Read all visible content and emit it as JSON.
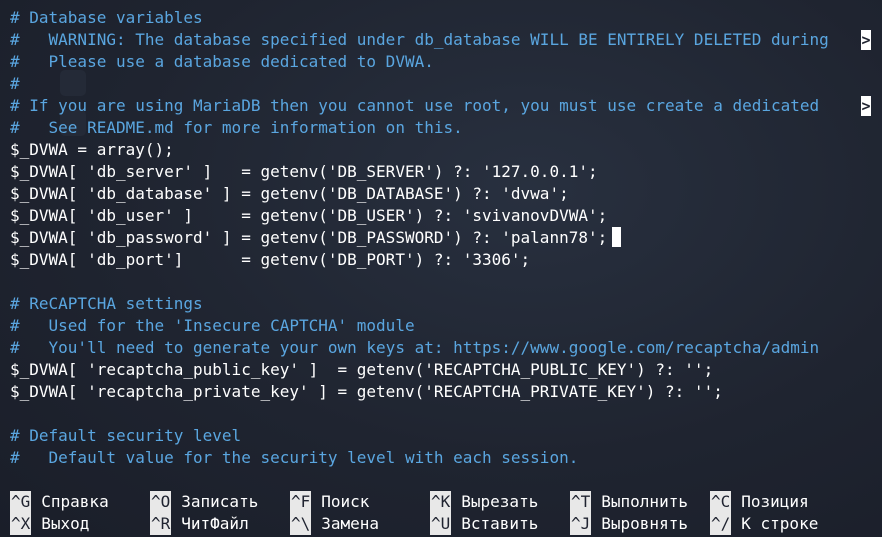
{
  "editor": {
    "lines": [
      {
        "text": "# Database variables",
        "kind": "comment"
      },
      {
        "text": "#   WARNING: The database specified under db_database WILL BE ENTIRELY DELETED during",
        "kind": "comment"
      },
      {
        "text": "#   Please use a database dedicated to DVWA.",
        "kind": "comment"
      },
      {
        "text": "#",
        "kind": "comment"
      },
      {
        "text": "# If you are using MariaDB then you cannot use root, you must use create a dedicated ",
        "kind": "comment"
      },
      {
        "text": "#   See README.md for more information on this.",
        "kind": "comment"
      },
      {
        "text": "$_DVWA = array();",
        "kind": "code"
      },
      {
        "text": "$_DVWA[ 'db_server' ]   = getenv('DB_SERVER') ?: '127.0.0.1';",
        "kind": "code"
      },
      {
        "text": "$_DVWA[ 'db_database' ] = getenv('DB_DATABASE') ?: 'dvwa';",
        "kind": "code"
      },
      {
        "text": "$_DVWA[ 'db_user' ]     = getenv('DB_USER') ?: 'svivanovDVWA';",
        "kind": "code"
      },
      {
        "text": "$_DVWA[ 'db_password' ] = getenv('DB_PASSWORD') ?: 'palann78';",
        "kind": "code"
      },
      {
        "text": "$_DVWA[ 'db_port']      = getenv('DB_PORT') ?: '3306';",
        "kind": "code"
      },
      {
        "text": "",
        "kind": "code"
      },
      {
        "text": "# ReCAPTCHA settings",
        "kind": "comment"
      },
      {
        "text": "#   Used for the 'Insecure CAPTCHA' module",
        "kind": "comment"
      },
      {
        "text": "#   You'll need to generate your own keys at: https://www.google.com/recaptcha/admin",
        "kind": "comment"
      },
      {
        "text": "$_DVWA[ 'recaptcha_public_key' ]  = getenv('RECAPTCHA_PUBLIC_KEY') ?: '';",
        "kind": "code"
      },
      {
        "text": "$_DVWA[ 'recaptcha_private_key' ] = getenv('RECAPTCHA_PRIVATE_KEY') ?: '';",
        "kind": "code"
      },
      {
        "text": "",
        "kind": "code"
      },
      {
        "text": "# Default security level",
        "kind": "comment"
      },
      {
        "text": "#   Default value for the security level with each session.",
        "kind": "comment"
      }
    ],
    "overflow_marker": ">"
  },
  "shortcuts": [
    {
      "key": "^G",
      "label": "Справка"
    },
    {
      "key": "^O",
      "label": "Записать"
    },
    {
      "key": "^F",
      "label": "Поиск"
    },
    {
      "key": "^K",
      "label": "Вырезать"
    },
    {
      "key": "^T",
      "label": "Выполнить"
    },
    {
      "key": "^C",
      "label": "Позиция"
    },
    {
      "key": "^X",
      "label": "Выход"
    },
    {
      "key": "^R",
      "label": "ЧитФайл"
    },
    {
      "key": "^\\",
      "label": "Замена"
    },
    {
      "key": "^U",
      "label": "Вставить"
    },
    {
      "key": "^J",
      "label": "Выровнять"
    },
    {
      "key": "^/",
      "label": "К строке"
    }
  ],
  "colors": {
    "background": "#1f2330",
    "comment": "#5aa6e0",
    "code": "#ffffff",
    "key_bg": "#e8e8e8"
  }
}
